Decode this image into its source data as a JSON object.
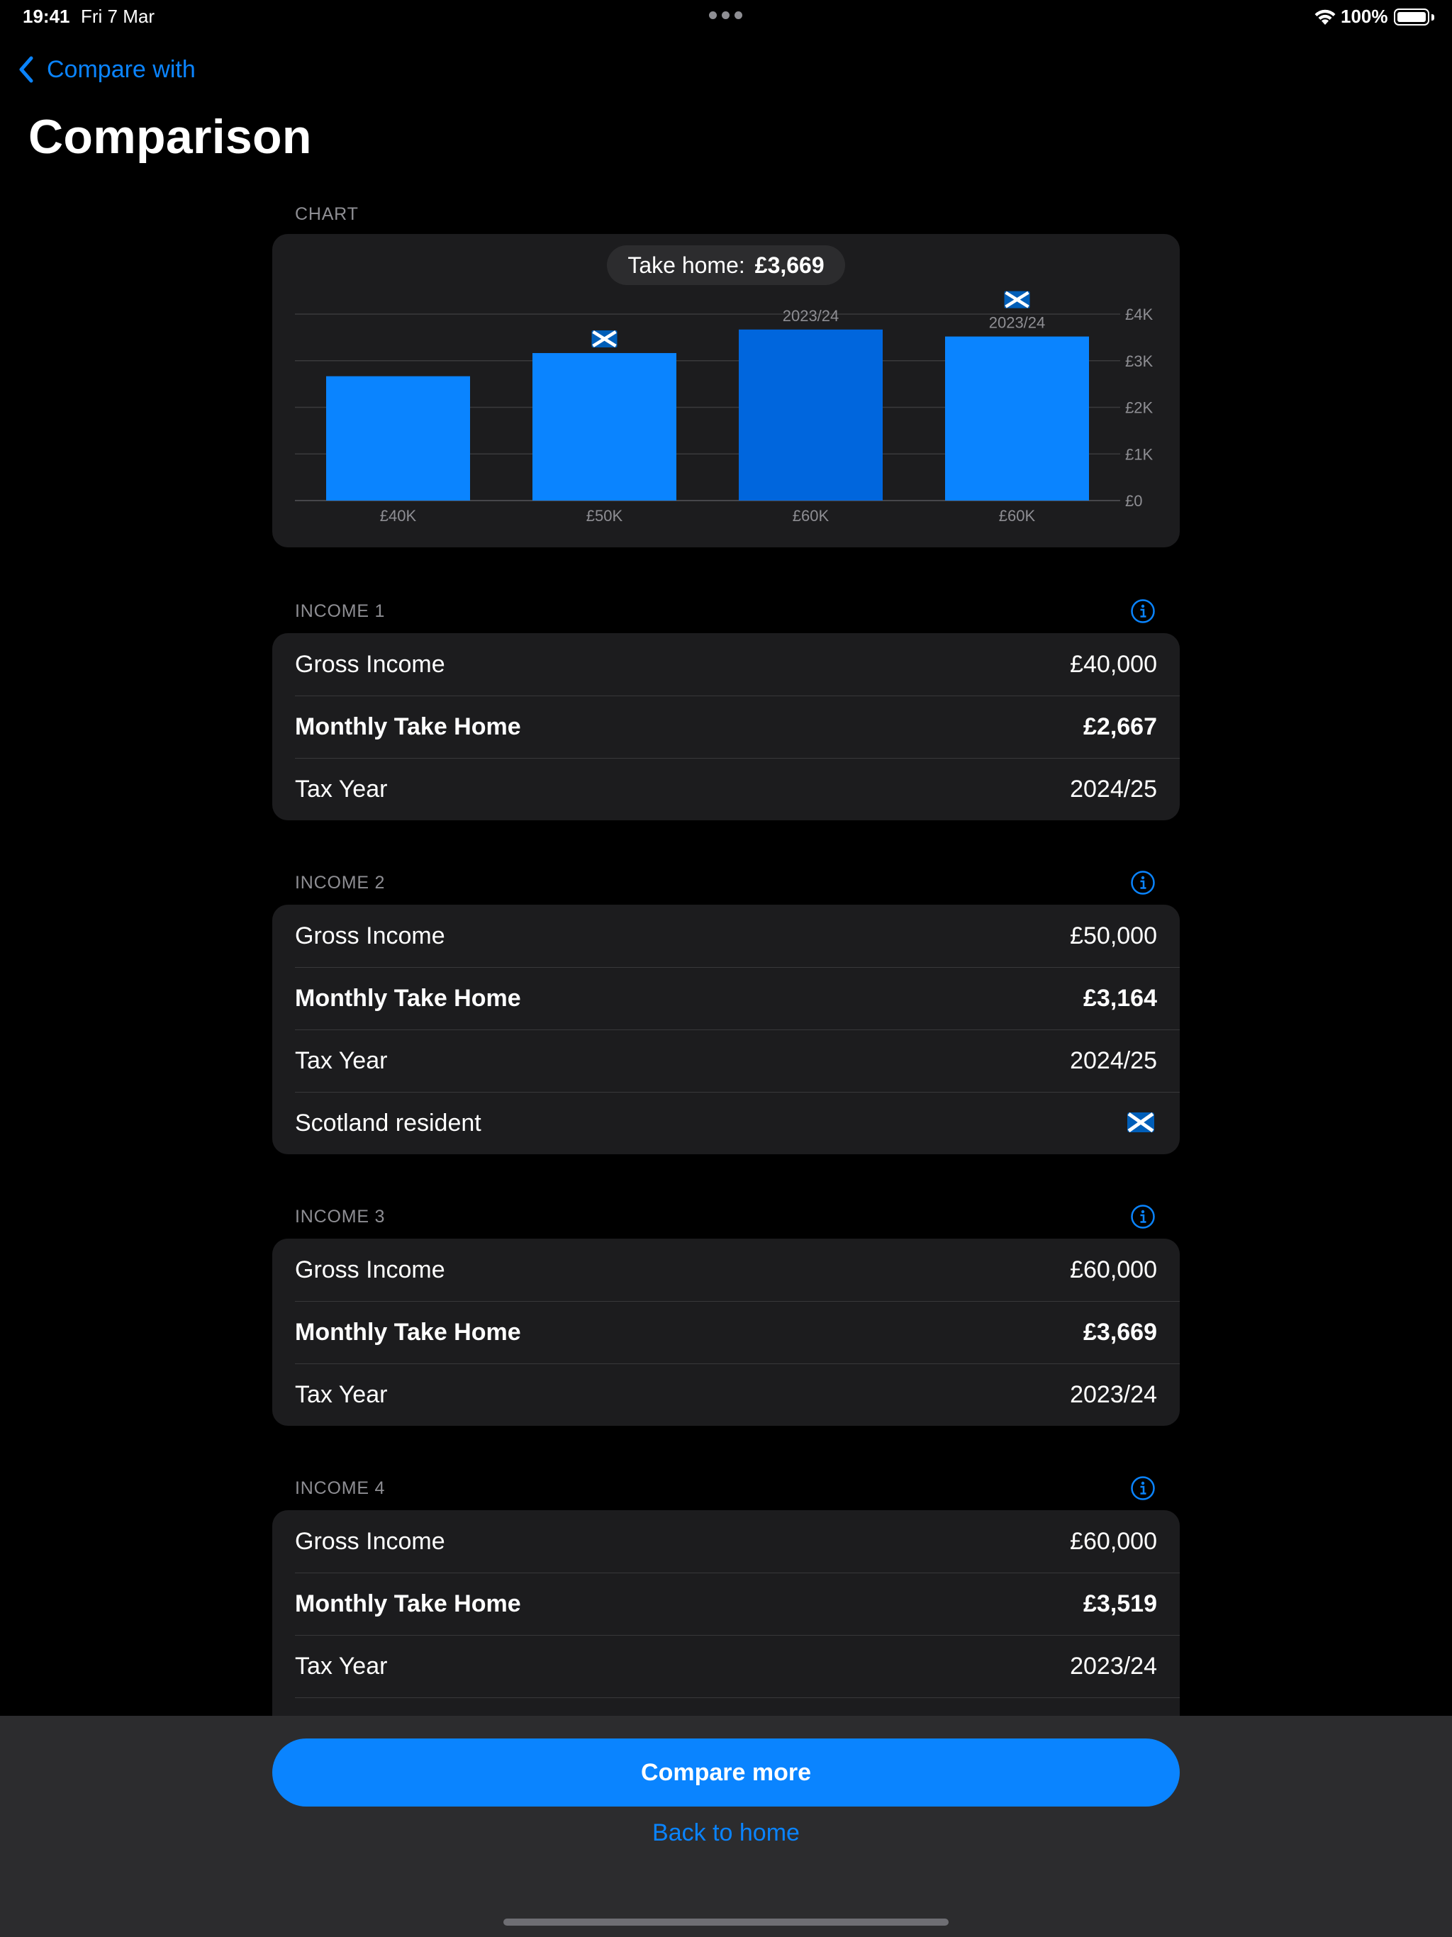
{
  "status_bar": {
    "time": "19:41",
    "date": "Fri 7 Mar",
    "battery": "100%"
  },
  "nav": {
    "back_label": "Compare with",
    "title": "Comparison"
  },
  "chart_section": {
    "header": "CHART"
  },
  "tooltip": {
    "label": "Take home:",
    "value": "£3,669"
  },
  "chart_data": {
    "type": "bar",
    "categories": [
      "£40K",
      "£50K",
      "£60K",
      "£60K"
    ],
    "values": [
      2667,
      3164,
      3669,
      3519
    ],
    "bar_annotations": [
      "",
      "",
      "2023/24",
      "2023/24"
    ],
    "bar_flags": [
      false,
      true,
      false,
      true
    ],
    "highlighted_index": 2,
    "ylim": [
      0,
      4000
    ],
    "yticks": [
      0,
      1000,
      2000,
      3000,
      4000
    ],
    "ytick_labels": [
      "£0",
      "£1K",
      "£2K",
      "£3K",
      "£4K"
    ],
    "grid": true,
    "colors": {
      "bar": "#0a84ff",
      "bar_selected": "#0066dd"
    }
  },
  "incomes": [
    {
      "header": "INCOME 1",
      "rows": [
        {
          "label": "Gross Income",
          "value": "£40,000"
        },
        {
          "label": "Monthly Take Home",
          "value": "£2,667",
          "bold": true
        },
        {
          "label": "Tax Year",
          "value": "2024/25"
        }
      ]
    },
    {
      "header": "INCOME 2",
      "rows": [
        {
          "label": "Gross Income",
          "value": "£50,000"
        },
        {
          "label": "Monthly Take Home",
          "value": "£3,164",
          "bold": true
        },
        {
          "label": "Tax Year",
          "value": "2024/25"
        },
        {
          "label": "Scotland resident",
          "flag": "scotland-flag-icon"
        }
      ]
    },
    {
      "header": "INCOME 3",
      "rows": [
        {
          "label": "Gross Income",
          "value": "£60,000"
        },
        {
          "label": "Monthly Take Home",
          "value": "£3,669",
          "bold": true
        },
        {
          "label": "Tax Year",
          "value": "2023/24"
        }
      ]
    },
    {
      "header": "INCOME 4",
      "rows": [
        {
          "label": "Gross Income",
          "value": "£60,000"
        },
        {
          "label": "Monthly Take Home",
          "value": "£3,519",
          "bold": true
        },
        {
          "label": "Tax Year",
          "value": "2023/24"
        }
      ]
    }
  ],
  "actions": {
    "compare_more": "Compare more",
    "back_home": "Back to home"
  },
  "colors": {
    "accent": "#0a84ff",
    "card": "#1c1c1e",
    "background": "#000000",
    "toolbar": "#2c2c2e"
  }
}
